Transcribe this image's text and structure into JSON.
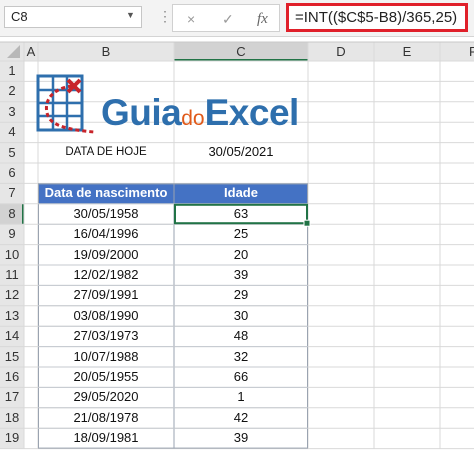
{
  "namebox": {
    "value": "C8"
  },
  "formula": {
    "value": "=INT(($C$5-B8)/365,25)"
  },
  "formula_buttons": {
    "cancel": "×",
    "confirm": "✓",
    "fx": "fx"
  },
  "columns": [
    "A",
    "B",
    "C",
    "D",
    "E",
    "F"
  ],
  "rows": [
    "1",
    "2",
    "3",
    "4",
    "5",
    "6",
    "7",
    "8",
    "9",
    "10",
    "11",
    "12",
    "13",
    "14",
    "15",
    "16",
    "17",
    "18",
    "19"
  ],
  "logo": {
    "part1": "Guia",
    "part2": "do",
    "part3": "Excel"
  },
  "today_label": "DATA DE HOJE",
  "today_value": "30/05/2021",
  "table": {
    "headers": [
      "Data de nascimento",
      "Idade"
    ],
    "rows": [
      [
        "30/05/1958",
        "63"
      ],
      [
        "16/04/1996",
        "25"
      ],
      [
        "19/09/2000",
        "20"
      ],
      [
        "12/02/1982",
        "39"
      ],
      [
        "27/09/1991",
        "29"
      ],
      [
        "03/08/1990",
        "30"
      ],
      [
        "27/03/1973",
        "48"
      ],
      [
        "10/07/1988",
        "32"
      ],
      [
        "20/05/1955",
        "66"
      ],
      [
        "29/05/2020",
        "1"
      ],
      [
        "21/08/1978",
        "42"
      ],
      [
        "18/09/1981",
        "39"
      ]
    ]
  },
  "colors": {
    "header_fill": "#4472c4",
    "selection": "#217346",
    "formula_highlight": "#e0202a",
    "logo_blue": "#2e6fad",
    "logo_orange": "#e05a1a"
  }
}
